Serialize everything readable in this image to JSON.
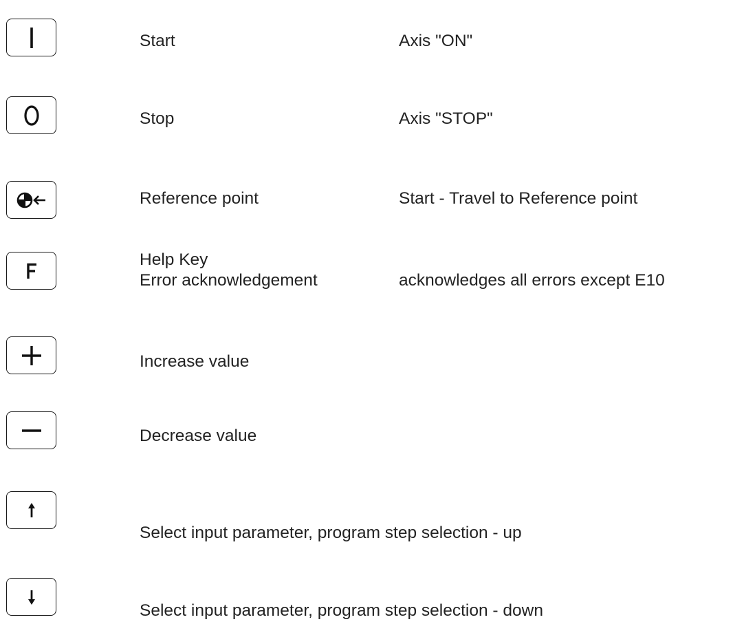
{
  "keys": [
    {
      "icon": "start-i-icon",
      "label": "Start",
      "desc": "Axis \"ON\""
    },
    {
      "icon": "stop-o-icon",
      "label": "Stop",
      "desc": "Axis \"STOP\""
    },
    {
      "icon": "reference-point-icon",
      "label": "Reference point",
      "desc": "Start - Travel to Reference point"
    },
    {
      "icon": "help-f-icon",
      "label": "Help Key",
      "label2": "Error acknowledgement",
      "desc": "acknowledges all errors except E10"
    },
    {
      "icon": "plus-icon",
      "label": "Increase value"
    },
    {
      "icon": "minus-icon",
      "label": "Decrease value"
    },
    {
      "icon": "arrow-up-icon",
      "label": "Select input parameter, program step selection - up"
    },
    {
      "icon": "arrow-down-icon",
      "label": "Select input parameter, program step selection - down"
    }
  ]
}
